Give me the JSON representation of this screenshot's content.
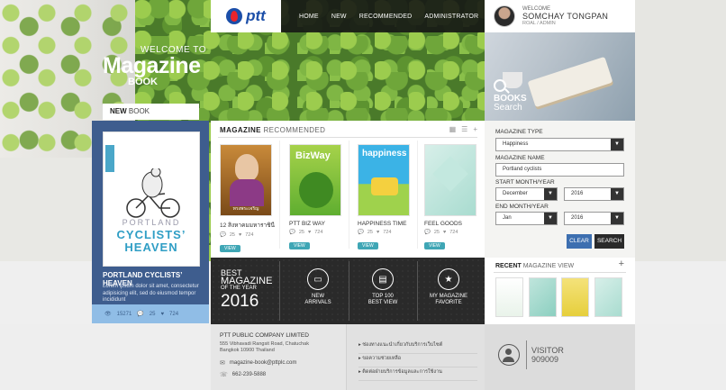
{
  "nav": {
    "home": "HOME",
    "new": "NEW",
    "recommended": "RECOMMENDED",
    "administrator": "ADMINISTRATOR"
  },
  "logo": {
    "text": "ptt"
  },
  "user": {
    "welcome": "WELCOME",
    "name": "SOMCHAY TONGPAN",
    "role": "ROAL / ADMIN"
  },
  "hero": {
    "line1": "WELCOME TO",
    "line2": "Magazine",
    "line3": "BOOK"
  },
  "books_search": {
    "line1": "BOOKS",
    "line2": "Search"
  },
  "new_book": {
    "tab_bold": "NEW",
    "tab_rest": " BOOK",
    "cover_portland": "PORTLAND",
    "cover_cyclists": "CYCLISTS’",
    "cover_heaven": "HEAVEN",
    "title": "PORTLAND CYCLISTS’ HEAVEN",
    "desc": "Lorem ipsum dolor sit amet, consectetur adipisicing elit, sed do eiusmod tempor incididunt",
    "views": "15271",
    "comments": "25",
    "likes": "724",
    "color_panel": "#3e5d8e",
    "color_stats": "#90bde6"
  },
  "recommended": {
    "head_bold": "MAGAZINE",
    "head_rest": " RECOMMENDED",
    "items": [
      {
        "title": "12 สิงหาคมมหาราชินี",
        "comments": "25",
        "likes": "724",
        "button": "VIEW",
        "cover_text": "ทรงพระเจริญ"
      },
      {
        "title": "PTT BIZ WAY",
        "comments": "25",
        "likes": "724",
        "button": "VIEW",
        "cover_text": "BizWay"
      },
      {
        "title": "HAPPINESS TIME",
        "comments": "25",
        "likes": "724",
        "button": "VIEW",
        "cover_text": "happiness"
      },
      {
        "title": "FEEL GOODS",
        "comments": "25",
        "likes": "724",
        "button": "VIEW",
        "cover_text": ""
      }
    ]
  },
  "best": {
    "line1": "BEST",
    "line2": "MAGAZINE",
    "line3": "OF THE YEAR",
    "year": "2016",
    "items": [
      {
        "label1": "NEW",
        "label2": "ARRIVALS"
      },
      {
        "label1": "TOP 100",
        "label2": "BEST VIEW"
      },
      {
        "label1": "MY MAGAZINE",
        "label2": "FAVORITE"
      }
    ]
  },
  "search": {
    "type_label": "MAGAZINE TYPE",
    "type_value": "Happiness",
    "name_label": "MAGAZINE NAME",
    "name_value": "Portland cyclists",
    "start_label": "START MONTH/YEAR",
    "start_month": "December",
    "start_year": "2016",
    "end_label": "END MONTH/YEAR",
    "end_month": "Jan",
    "end_year": "2016",
    "clear": "CLEAR",
    "search": "SEARCH",
    "clear_color": "#3d6fb0",
    "search_color": "#2a2a2a"
  },
  "recent": {
    "head_bold": "RECENT",
    "head_rest": " MAGAZINE VIEW",
    "plus": "+"
  },
  "footer": {
    "company": "PTT PUBLIC COMPANY LIMITED",
    "address1": "555 Vibhavadi Rangsit Road, Chatuchak",
    "address2": "Bangkok 10900 Thailand",
    "email": "magazine-book@pttplc.com",
    "phone": "662-239-5888",
    "links": [
      "ช่องทางแนะนำเกี่ยวกับบริการเว็บไซต์",
      "ขอความช่วยเหลือ",
      "ติดต่อฝ่ายบริการข้อมูลและการใช้งาน"
    ],
    "visitor_label": "VISITOR",
    "visitor_count": "909009"
  }
}
